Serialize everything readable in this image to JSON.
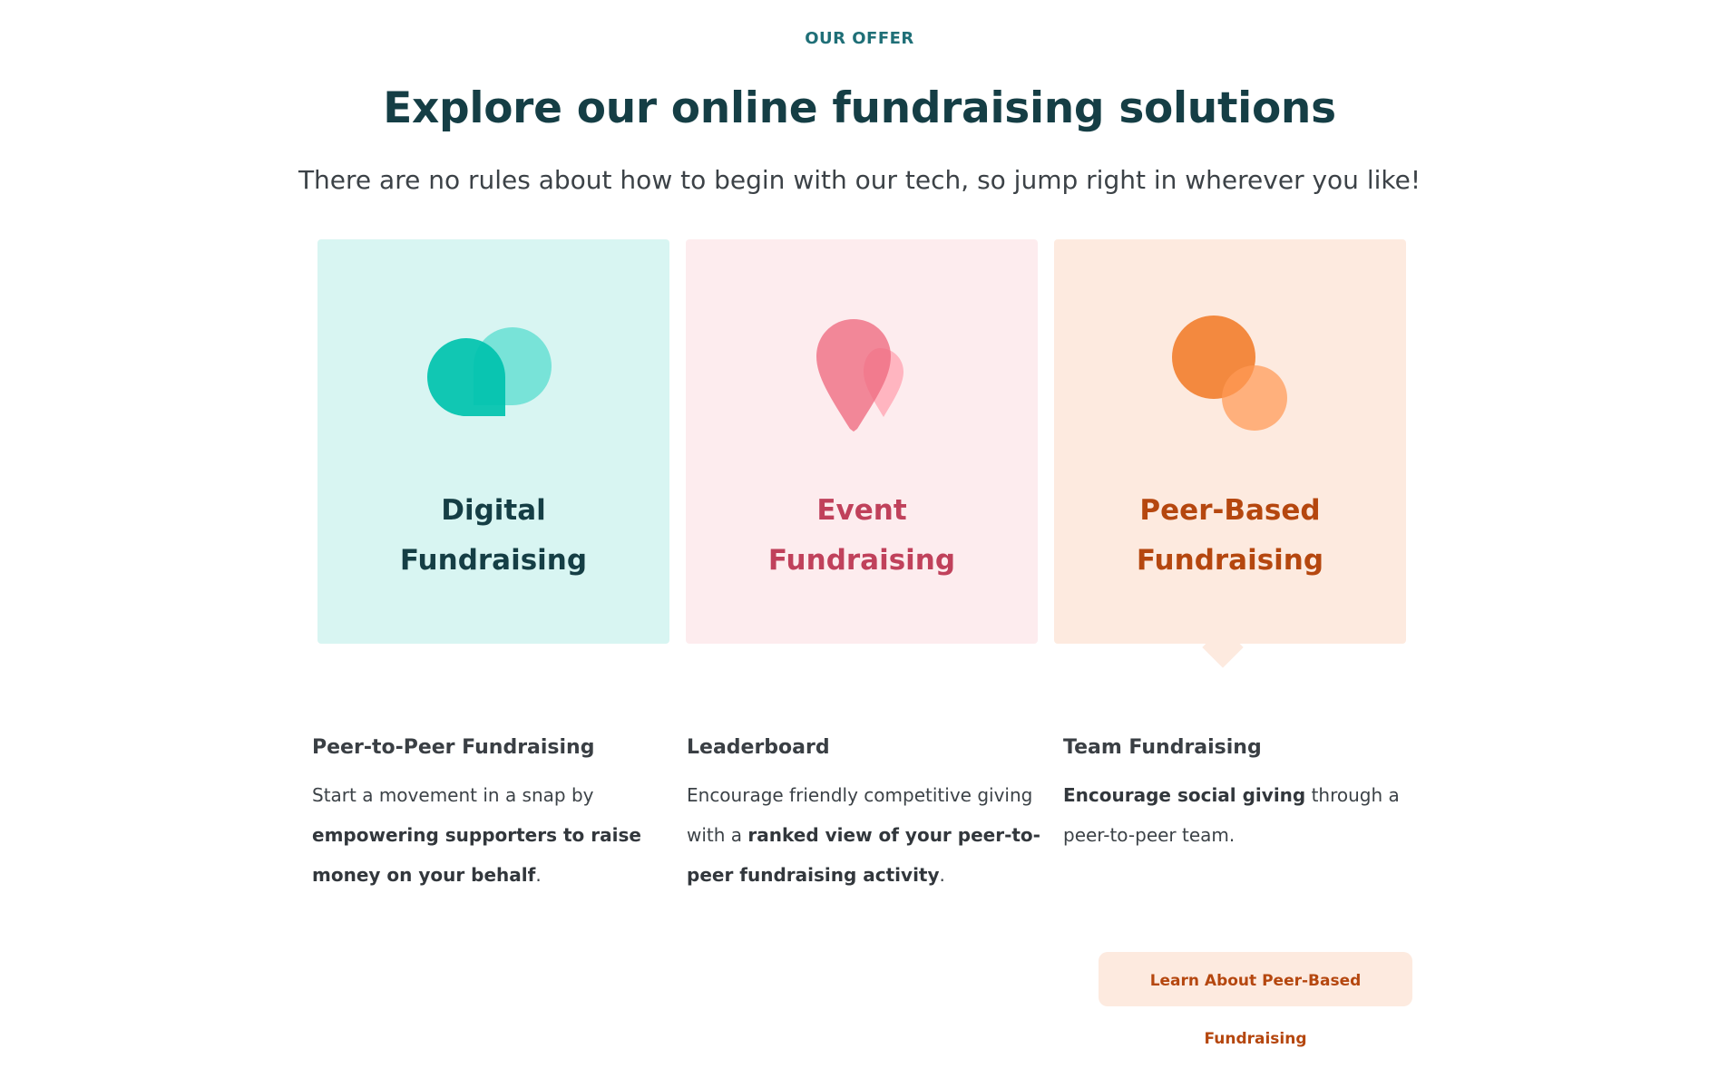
{
  "section": {
    "eyebrow": "OUR OFFER",
    "title": "Explore our online fundraising solutions",
    "subtitle": "There are no rules about how to begin with our tech, so jump right in wherever you like!"
  },
  "cards": [
    {
      "line1": "Digital",
      "line2": "Fundraising",
      "icon": "chat-bubbles-icon",
      "color": "#153e45",
      "bg": "#d8f5f2"
    },
    {
      "line1": "Event",
      "line2": "Fundraising",
      "icon": "map-pins-icon",
      "color": "#c0415b",
      "bg": "#fdecee"
    },
    {
      "line1": "Peer-Based",
      "line2": "Fundraising",
      "icon": "overlapping-circles-icon",
      "color": "#b5470f",
      "bg": "#fdeadf",
      "selected": true
    }
  ],
  "features": [
    {
      "title": "Peer-to-Peer Fundraising",
      "text_before": "Start a movement in a snap by ",
      "text_bold": "empowering supporters to raise money on your behalf",
      "text_after": "."
    },
    {
      "title": "Leaderboard",
      "text_before": "Encourage friendly competitive giving with a ",
      "text_bold": "ranked view of your peer-to-peer fundraising activity",
      "text_after": "."
    },
    {
      "title": "Team Fundraising",
      "text_before": "",
      "text_bold": "Encourage social giving",
      "text_after": " through a peer-to-peer team."
    }
  ],
  "cta": {
    "label": "Learn About Peer-Based Fundraising"
  }
}
